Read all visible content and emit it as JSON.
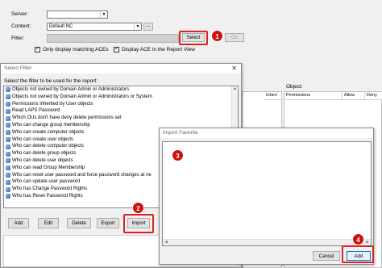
{
  "main": {
    "server_label": "Server:",
    "server_value": "",
    "context_label": "Context:",
    "context_value": "Default NC",
    "context_browse": "...",
    "filter_label": "Filter:",
    "select_button": "Select",
    "go_button": "Go",
    "only_matching_label": "Only display matching ACEs",
    "only_matching_checked": true,
    "display_ace_label": "Display ACE in the Report View",
    "display_ace_checked": true,
    "object_label": "Object:",
    "columns_left": [
      "Inheri"
    ],
    "columns_right": [
      "Permissions",
      "Allow",
      "Deny"
    ]
  },
  "select_filter": {
    "title": "Select Filter",
    "instruction": "Select the filter to be used for the report:",
    "items": [
      "Objects not owned by Domain Admin or Administrators",
      "Objects not owned by Domain Admin or Administrators or System",
      "Permissions inherited by User objects",
      "Read LAPS Password",
      "Which OUs don't have deny delete permissions set",
      "Who can change group membership",
      "Who can create computer objects",
      "Who can create user objects",
      "Who can delete computer objects",
      "Who can delete group objects",
      "Who can delete user objects",
      "Who can read Group Membership",
      "Who can reset user password and force password changes at ne",
      "Who can update user password",
      "Who has Change Password Rights",
      "Who has Reset Password Rights"
    ],
    "buttons": {
      "add": "Add",
      "edit": "Edit",
      "delete": "Delete",
      "export": "Export",
      "import": "Import"
    }
  },
  "import_favorite": {
    "title": "Import Favorite",
    "textarea_value": "",
    "cancel": "Cancel",
    "add": "Add"
  },
  "callouts": [
    "1",
    "2",
    "3",
    "4"
  ],
  "colors": {
    "callout_red": "#d01010",
    "highlight_red": "#e02020"
  }
}
